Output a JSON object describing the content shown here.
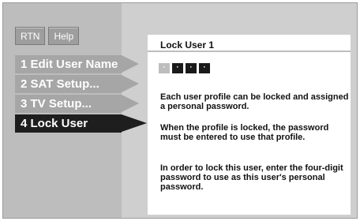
{
  "toolbar": {
    "rtn_label": "RTN",
    "help_label": "Help"
  },
  "menu": {
    "items": [
      {
        "label": "1 Edit User Name",
        "state": "inactive"
      },
      {
        "label": "2 SAT Setup...",
        "state": "inactive"
      },
      {
        "label": "3 TV Setup...",
        "state": "inactive"
      },
      {
        "label": "4 Lock User",
        "state": "selected"
      }
    ]
  },
  "panel": {
    "title": "Lock User 1",
    "pin_digits": [
      "·",
      "·",
      "·",
      "·"
    ],
    "paragraphs": [
      "Each user profile can be locked and assigned a personal password.",
      "When the profile is locked, the password must be entered to use that profile.",
      "In order to lock this user, enter the four-digit password to use as this user's personal password."
    ]
  },
  "colors": {
    "selected_item": "#1e1e1e",
    "menu_item": "#a6a6a6",
    "panel_bg": "#ffffff",
    "frame_bg": "#cfcfcf"
  }
}
